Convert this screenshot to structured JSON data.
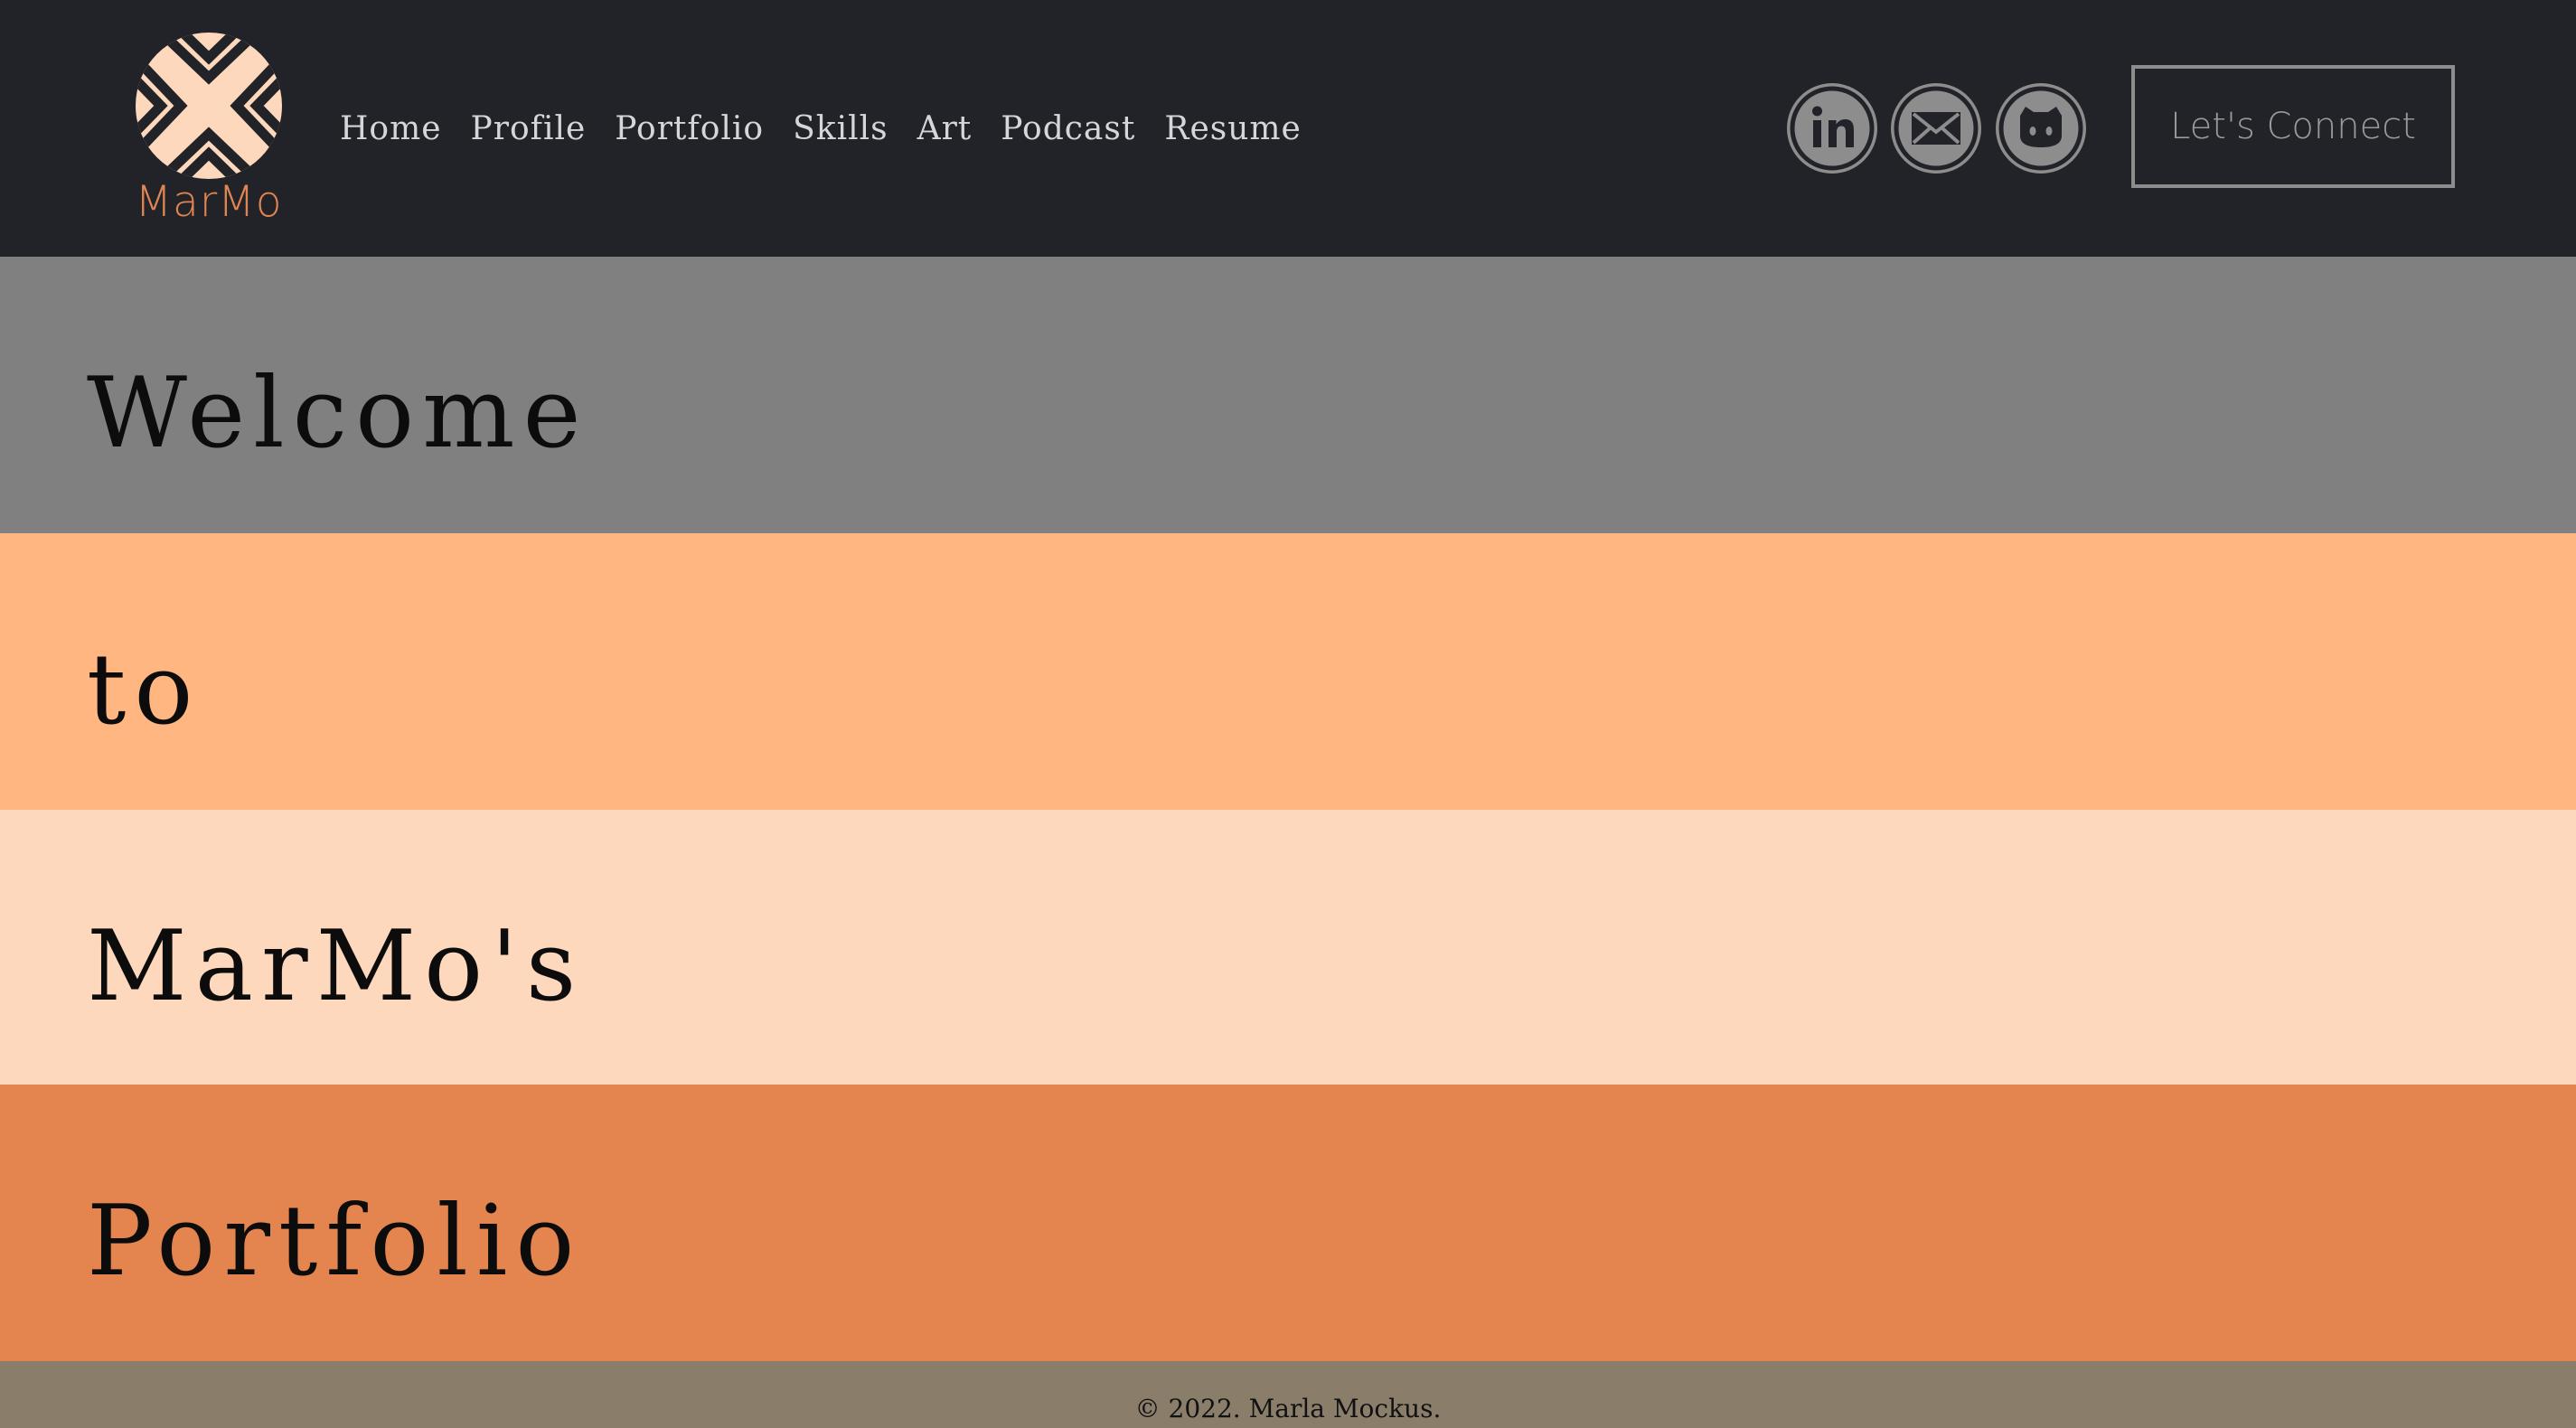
{
  "header": {
    "logo_text": "MarMo",
    "nav": [
      "Home",
      "Profile",
      "Portfolio",
      "Skills",
      "Art",
      "Podcast",
      "Resume"
    ],
    "social_icons": [
      "linkedin-icon",
      "email-icon",
      "github-icon"
    ],
    "connect_label": "Let's Connect"
  },
  "hero": {
    "lines": [
      "Welcome",
      "to",
      "MarMo's",
      "Portfolio"
    ]
  },
  "footer": {
    "copyright": "© 2022. Marla Mockus."
  },
  "colors": {
    "header_bg": "#212329",
    "band_1": "#808080",
    "band_2": "#ffb680",
    "band_3": "#fdd8bd",
    "band_4": "#e4854f",
    "footer_bg": "#8a7e6b",
    "accent": "#e08551",
    "logo_fill": "#fdd8bd"
  }
}
